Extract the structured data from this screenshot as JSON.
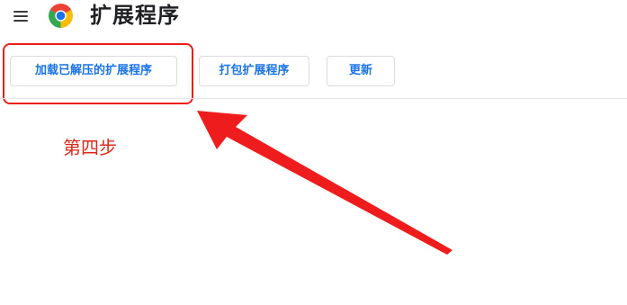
{
  "header": {
    "menu_icon": "hamburger-menu-icon",
    "logo_icon": "chrome-logo-icon",
    "title": "扩展程序"
  },
  "toolbar": {
    "load_unpacked_label": "加载已解压的扩展程序",
    "pack_extension_label": "打包扩展程序",
    "update_label": "更新"
  },
  "annotation": {
    "step_text": "第四步",
    "highlight_color": "#ef1c1c",
    "arrow_icon": "red-arrow-icon"
  },
  "colors": {
    "accent": "#1a73e8",
    "title": "#202124",
    "annotation": "#d92a1c"
  }
}
